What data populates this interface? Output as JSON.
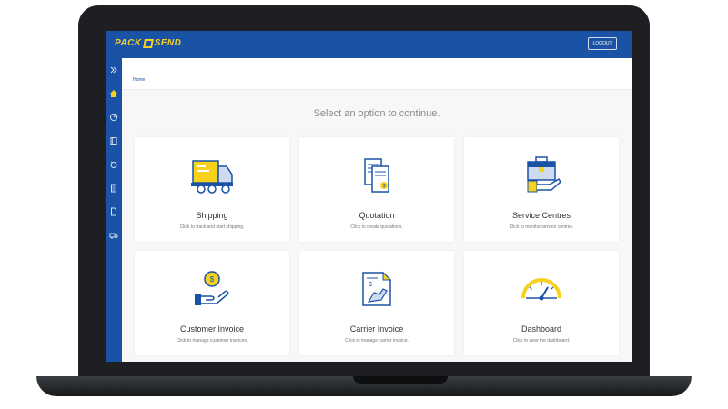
{
  "colors": {
    "brand_blue": "#1a53a6",
    "accent_yellow": "#f6d21e"
  },
  "header": {
    "logo_left": "PACK",
    "logo_right": "SEND",
    "logout_label": "LOGOUT"
  },
  "sidebar": {
    "items": [
      {
        "icon": "chevron-double-right-icon"
      },
      {
        "icon": "home-icon"
      },
      {
        "icon": "gauge-icon"
      },
      {
        "icon": "book-icon"
      },
      {
        "icon": "alarm-icon"
      },
      {
        "icon": "calculator-icon"
      },
      {
        "icon": "document-icon"
      },
      {
        "icon": "truck-icon"
      }
    ]
  },
  "breadcrumb": "Home",
  "main": {
    "heading": "Select an option to continue.",
    "cards": [
      {
        "title": "Shipping",
        "desc": "Click to track and start shipping.",
        "icon": "truck-icon"
      },
      {
        "title": "Quotation",
        "desc": "Click to create quotations.",
        "icon": "quotation-icon"
      },
      {
        "title": "Service Centres",
        "desc": "Click to monitor service centres.",
        "icon": "briefcase-hand-icon"
      },
      {
        "title": "Customer Invoice",
        "desc": "Click to manage customer invoices.",
        "icon": "coin-hand-icon"
      },
      {
        "title": "Carrier Invoice",
        "desc": "Click to manage carrier invoice.",
        "icon": "invoice-hand-icon"
      },
      {
        "title": "Dashboard",
        "desc": "Click to view the dashboard.",
        "icon": "speedometer-icon"
      }
    ]
  }
}
